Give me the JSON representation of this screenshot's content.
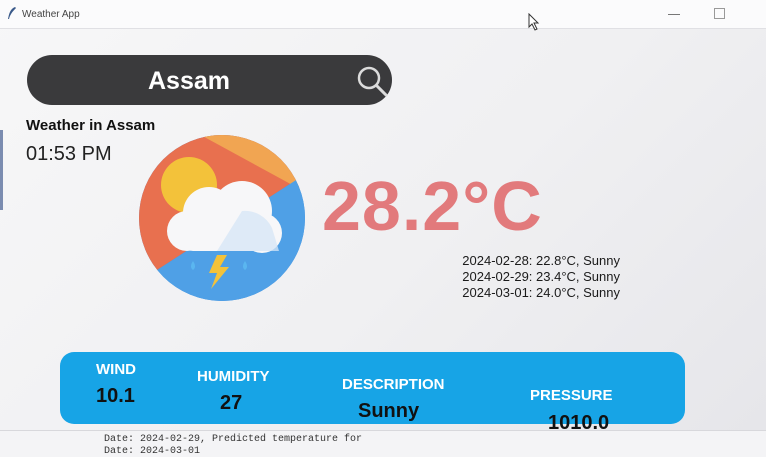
{
  "window": {
    "title": "Weather App"
  },
  "search": {
    "value": "Assam"
  },
  "location": {
    "heading": "Weather in Assam",
    "time": "01:53 PM"
  },
  "current": {
    "temperature": "28.2°C"
  },
  "forecast": [
    "2024-02-28: 22.8°C, Sunny",
    "2024-02-29: 23.4°C, Sunny",
    "2024-03-01: 24.0°C, Sunny"
  ],
  "info": {
    "wind": {
      "label": "WIND",
      "value": "10.1"
    },
    "humidity": {
      "label": "HUMIDITY",
      "value": "27"
    },
    "description": {
      "label": "DESCRIPTION",
      "value": "Sunny"
    },
    "pressure": {
      "label": "PRESSURE",
      "value": "1010.0"
    }
  },
  "console": {
    "lines": [
      "Date: 2024-02-29, Predicted temperature for",
      "Date: 2024-03-01"
    ]
  },
  "colors": {
    "temperature": "#e27a7c",
    "panel": "#17a4e6",
    "search_bar": "#3a3a3c"
  },
  "icons": {
    "weather": "sun-cloud-rain-lightning-icon",
    "search": "search-icon"
  }
}
